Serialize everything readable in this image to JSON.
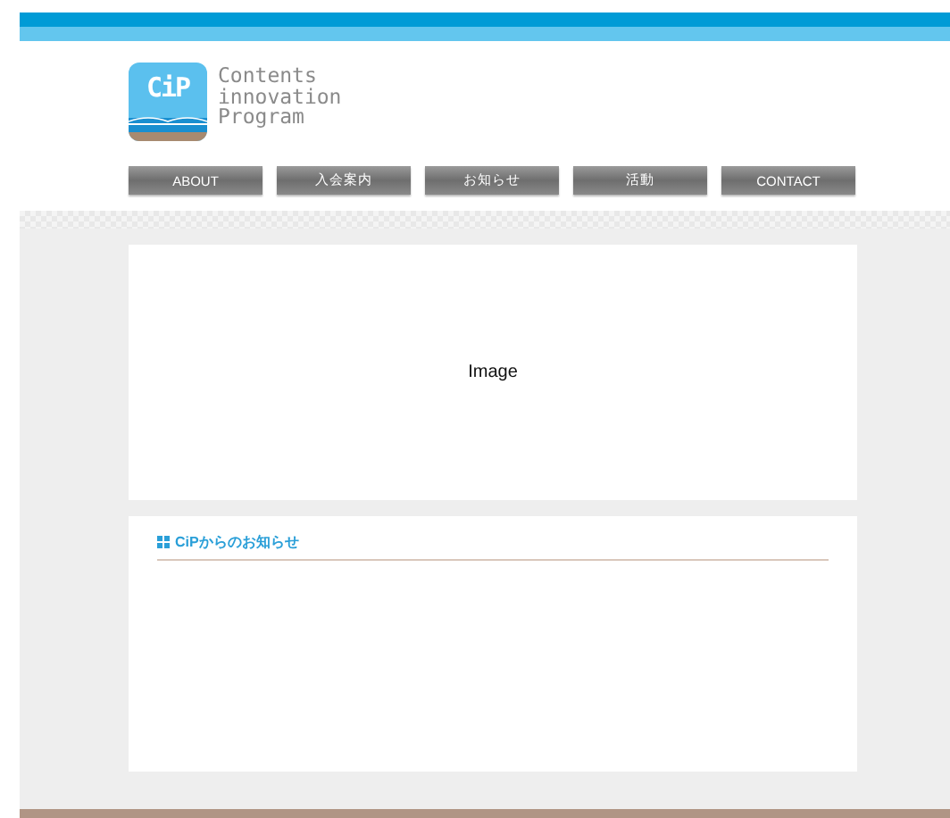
{
  "logo": {
    "mark": "CiP",
    "lines": [
      "Contents",
      "innovation",
      "Program"
    ]
  },
  "nav": [
    {
      "label": "ABOUT"
    },
    {
      "label": "入会案内"
    },
    {
      "label": "お知らせ"
    },
    {
      "label": "活動"
    },
    {
      "label": "CONTACT"
    }
  ],
  "hero": {
    "label": "Image"
  },
  "news": {
    "title": "CiPからのお知らせ"
  }
}
